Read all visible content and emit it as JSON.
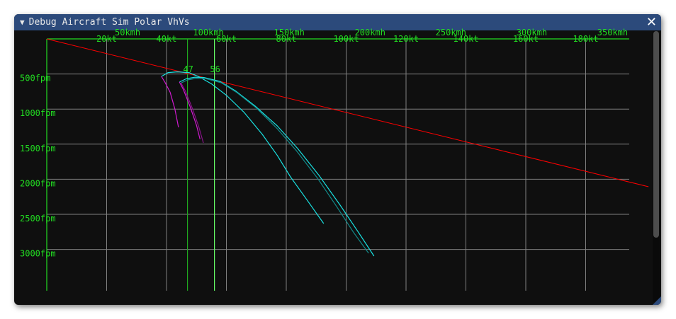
{
  "window": {
    "title": "Debug Aircraft Sim Polar VhVs",
    "collapse_icon": "triangle-down",
    "close_icon": "close-x"
  },
  "colors": {
    "axis": "#22dd22",
    "grid": "#808080",
    "glide_line": "#ff0000",
    "cyan": "#19e0e0",
    "magenta": "#d01ad0",
    "titlebar": "#2c4a7b"
  },
  "chart_data": {
    "type": "line",
    "xlabel": "",
    "ylabel": "",
    "x_unit": "kt",
    "y_unit": "fpm",
    "y_inverted": true,
    "xlim": [
      0,
      194
    ],
    "ylim": [
      0,
      3600
    ],
    "grid": true,
    "x_ticks_kt": [
      "20kt",
      "40kt",
      "60kt",
      "80kt",
      "100kt",
      "120kt",
      "140kt",
      "160kt",
      "180kt"
    ],
    "x_ticks_kmh": [
      "50kmh",
      "100kmh",
      "150kmh",
      "200kmh",
      "250kmh",
      "300kmh",
      "350kmh"
    ],
    "y_ticks": [
      "500fpm",
      "1000fpm",
      "1500fpm",
      "2000fpm",
      "2500fpm",
      "3000fpm"
    ],
    "markers": [
      {
        "label": "47",
        "x": 47,
        "color": "#1fa81f"
      },
      {
        "label": "56",
        "x": 56,
        "color": "#66ff66"
      }
    ],
    "glide_line": {
      "x": [
        0,
        201
      ],
      "y": [
        0,
        2107
      ]
    },
    "series": [
      {
        "color": "#19e0e0",
        "x": [
          38.3,
          40.5,
          43.5,
          47.5,
          50.6,
          55,
          60.1,
          66,
          72,
          77,
          81.4,
          87,
          92.5
        ],
        "y": [
          535,
          480,
          470,
          480,
          534,
          640,
          806,
          1050,
          1361,
          1660,
          1966,
          2300,
          2631
        ]
      },
      {
        "color": "#19e0e0",
        "x": [
          44.3,
          46.5,
          49.5,
          52.5,
          57.8,
          63,
          69.6,
          77,
          83.8,
          91,
          98,
          104,
          109.3
        ],
        "y": [
          615,
          570,
          545,
          550,
          605,
          740,
          958,
          1240,
          1563,
          1950,
          2369,
          2750,
          3095
        ]
      },
      {
        "color": "#128a8a",
        "x": [
          44.8,
          47,
          50,
          53,
          58.3,
          63.5,
          70,
          77,
          83.5,
          90.5,
          97,
          102.5,
          107.5
        ],
        "y": [
          630,
          585,
          560,
          565,
          625,
          765,
          985,
          1280,
          1600,
          1990,
          2400,
          2760,
          3054
        ]
      },
      {
        "color": "#d01ad0",
        "x": [
          38.3,
          39.5,
          41.2,
          42.8,
          44
        ],
        "y": [
          535,
          620,
          760,
          1000,
          1260
        ]
      },
      {
        "color": "#d01ad0",
        "x": [
          44.3,
          45.6,
          47.8,
          50,
          51.2
        ],
        "y": [
          615,
          720,
          958,
          1230,
          1430
        ]
      },
      {
        "color": "#8a128a",
        "x": [
          44.8,
          46.2,
          48.5,
          50.8,
          52.3
        ],
        "y": [
          625,
          735,
          975,
          1255,
          1482
        ]
      }
    ]
  }
}
